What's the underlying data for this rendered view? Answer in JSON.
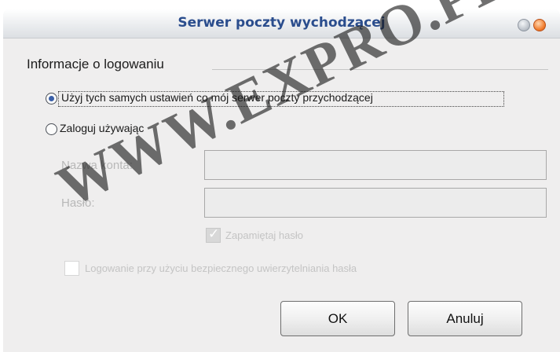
{
  "window": {
    "title": "Serwer poczty wychodzącej",
    "controls": [
      "minimize-icon",
      "close-icon"
    ],
    "accent": "#2a4d8d"
  },
  "group": {
    "label": "Informacje o logowaniu"
  },
  "options": {
    "same_settings": {
      "label": "Użyj tych samych ustawień co mój serwer poczty przychodzącej",
      "checked": true
    },
    "login_using": {
      "label": "Zaloguj używając",
      "checked": false
    }
  },
  "fields": {
    "account": {
      "label": "Nazwa konta:",
      "value": ""
    },
    "password": {
      "label": "Hasło:",
      "value": ""
    }
  },
  "checks": {
    "remember": {
      "label": "Zapamiętaj hasło",
      "checked": true
    },
    "spa": {
      "label": "Logowanie przy użyciu bezpiecznego uwierzytelniania hasła",
      "checked": false
    }
  },
  "buttons": {
    "ok": "OK",
    "cancel": "Anuluj"
  },
  "watermark": "WWW.EXPRO.PL"
}
